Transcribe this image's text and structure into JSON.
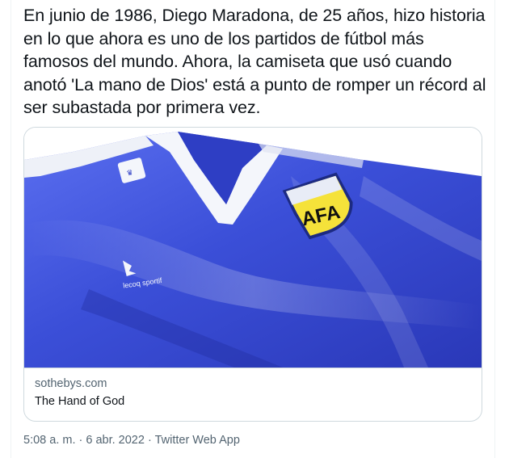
{
  "tweet": {
    "text": "En junio de 1986, Diego Maradona, de 25 años, hizo historia en lo que ahora es uno de los partidos de fútbol más famosos del mundo. Ahora, la camiseta que usó cuando anotó 'La mano de Dios' está a punto de romper un récord al ser subastada por primera vez.",
    "card": {
      "domain": "sothebys.com",
      "title": "The Hand of God"
    },
    "meta": {
      "time": "5:08 a. m.",
      "separator1": " · ",
      "date": "6 abr. 2022",
      "separator2": " · ",
      "source": "Twitter Web App"
    }
  },
  "colors": {
    "text": "#0f1419",
    "secondary": "#536471",
    "border": "#cfd9de",
    "shirt_blue": "#3a4fd6",
    "collar_white": "#f4f6fb",
    "badge_yellow": "#f5e23a"
  }
}
